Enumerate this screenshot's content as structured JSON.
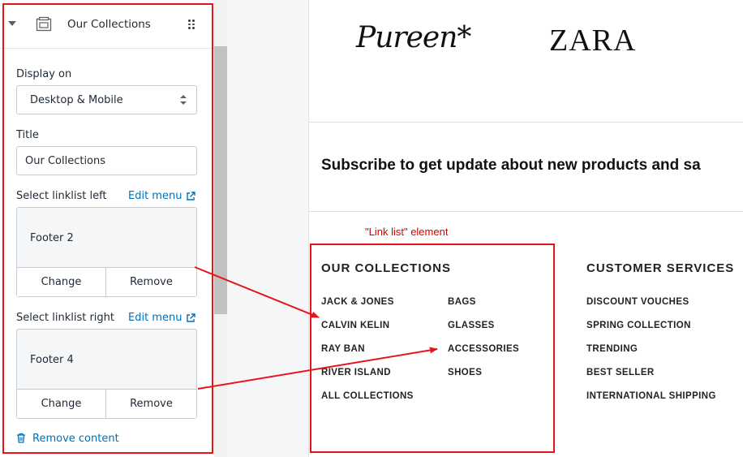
{
  "panel": {
    "title": "Our Collections",
    "display_label": "Display on",
    "display_value": "Desktop & Mobile",
    "title_label": "Title",
    "title_value": "Our Collections",
    "left_label": "Select linklist left",
    "right_label": "Select linklist right",
    "edit_menu": "Edit menu",
    "left_card": {
      "value": "Footer 2",
      "change": "Change",
      "remove": "Remove"
    },
    "right_card": {
      "value": "Footer 4",
      "change": "Change",
      "remove": "Remove"
    },
    "remove_content": "Remove content"
  },
  "preview": {
    "logos": [
      "Pureen*",
      "ZARA"
    ],
    "subscribe": "Subscribe to get update about new products and sa",
    "annotation": "\"Link list\" element",
    "col1": {
      "heading": "OUR COLLECTIONS",
      "left_links": [
        "JACK & JONES",
        "CALVIN KELIN",
        "RAY BAN",
        "RIVER ISLAND",
        "ALL COLLECTIONS"
      ],
      "right_links": [
        "BAGS",
        "GLASSES",
        "ACCESSORIES",
        "SHOES"
      ]
    },
    "col2": {
      "heading": "CUSTOMER SERVICES",
      "links": [
        "DISCOUNT VOUCHES",
        "SPRING COLLECTION",
        "TRENDING",
        "BEST SELLER",
        "INTERNATIONAL SHIPPING"
      ]
    }
  },
  "colors": {
    "annotation_red": "#e8141b",
    "link_blue": "#006fbb"
  }
}
